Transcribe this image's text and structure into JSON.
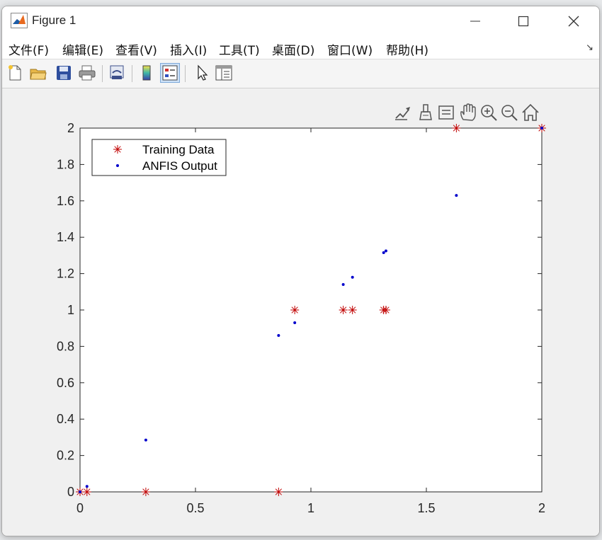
{
  "window": {
    "title": "Figure 1"
  },
  "menu": {
    "items": [
      "文件(F)",
      "编辑(E)",
      "查看(V)",
      "插入(I)",
      "工具(T)",
      "桌面(D)",
      "窗口(W)",
      "帮助(H)"
    ]
  },
  "toolbar": {
    "icons": [
      "new-figure-icon",
      "open-file-icon",
      "save-icon",
      "print-icon",
      "link-plot-icon",
      "colorbar-icon",
      "legend-icon",
      "select-pointer-icon",
      "property-inspector-icon"
    ]
  },
  "axes_toolbar": {
    "icons": [
      "export-icon",
      "brush-icon",
      "datatip-icon",
      "pan-icon",
      "zoom-in-icon",
      "zoom-out-icon",
      "home-icon"
    ]
  },
  "chart_data": {
    "type": "scatter",
    "title": "",
    "xlabel": "",
    "ylabel": "",
    "xlim": [
      0,
      2
    ],
    "ylim": [
      0,
      2
    ],
    "xticks": [
      "0",
      "0.5",
      "1",
      "1.5",
      "2"
    ],
    "yticks": [
      "0",
      "0.2",
      "0.4",
      "0.6",
      "0.8",
      "1",
      "1.2",
      "1.4",
      "1.6",
      "1.8",
      "2"
    ],
    "grid": false,
    "legend_position": "top-left",
    "series": [
      {
        "name": "Training Data",
        "marker": "asterisk",
        "color": "#c00000",
        "points": [
          [
            0.0,
            0
          ],
          [
            0.03,
            0
          ],
          [
            0.285,
            0
          ],
          [
            0.86,
            0
          ],
          [
            0.93,
            1
          ],
          [
            1.14,
            1
          ],
          [
            1.18,
            1
          ],
          [
            1.315,
            1
          ],
          [
            1.325,
            1
          ],
          [
            1.63,
            2
          ],
          [
            2.0,
            2
          ]
        ]
      },
      {
        "name": "ANFIS Output",
        "marker": "dot",
        "color": "#0000cc",
        "points": [
          [
            0.0,
            0.0
          ],
          [
            0.03,
            0.03
          ],
          [
            0.285,
            0.285
          ],
          [
            0.86,
            0.86
          ],
          [
            0.93,
            0.93
          ],
          [
            1.14,
            1.14
          ],
          [
            1.18,
            1.18
          ],
          [
            1.315,
            1.315
          ],
          [
            1.325,
            1.325
          ],
          [
            1.63,
            1.63
          ],
          [
            2.0,
            2.0
          ]
        ]
      }
    ]
  }
}
